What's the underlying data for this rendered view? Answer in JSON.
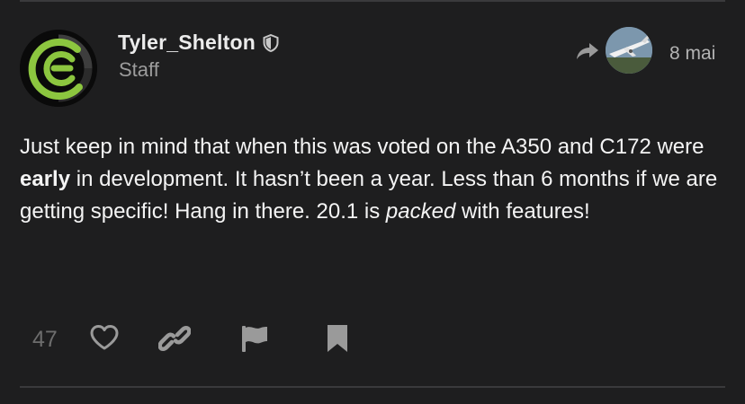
{
  "post": {
    "username": "Tyler_Shelton",
    "user_title": "Staff",
    "date": "8 mai",
    "body": {
      "p1": "Just keep in mind that when this was voted on the A350 and C172 were ",
      "bold": "early",
      "p2": " in development. It hasn’t been a year. Less than 6 months if we are getting specific! Hang in there. 20.1 is ",
      "italic": "packed",
      "p3": " with features!"
    }
  },
  "actions": {
    "like_count": "47"
  },
  "icons": {
    "moderator": "shield-icon",
    "reply": "reply-arrow-icon",
    "like": "heart-icon",
    "share": "link-icon",
    "flag": "flag-icon",
    "bookmark": "bookmark-icon"
  },
  "colors": {
    "background": "#1e1e1f",
    "text": "#f4f4f4",
    "muted": "#9c9c9c",
    "icon": "#9a9a9a",
    "avatar_accent": "#8cc63f"
  }
}
